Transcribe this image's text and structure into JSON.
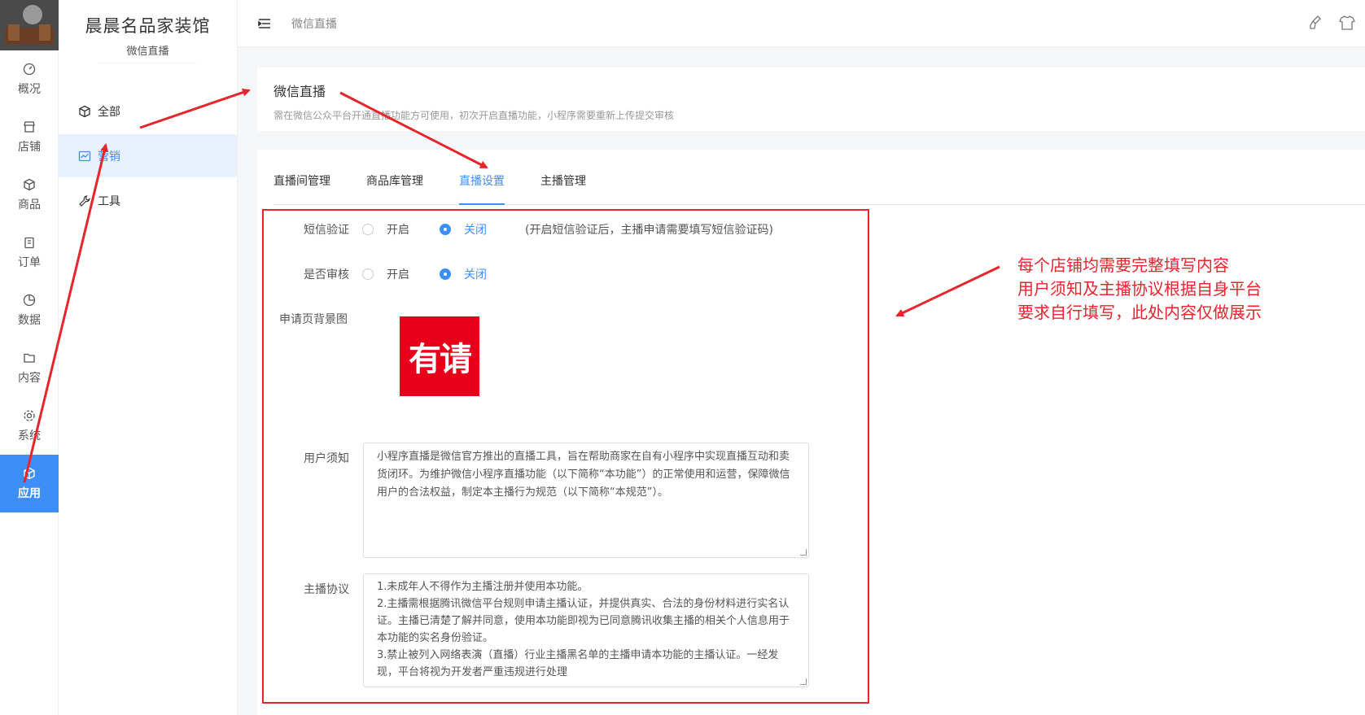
{
  "rail": {
    "items": [
      {
        "label": "概况",
        "icon": "dashboard-icon"
      },
      {
        "label": "店铺",
        "icon": "store-icon"
      },
      {
        "label": "商品",
        "icon": "cube-icon"
      },
      {
        "label": "订单",
        "icon": "clipboard-icon"
      },
      {
        "label": "数据",
        "icon": "pie-chart-icon"
      },
      {
        "label": "内容",
        "icon": "folder-icon"
      },
      {
        "label": "系统",
        "icon": "gear-icon"
      },
      {
        "label": "应用",
        "icon": "cube-icon",
        "active": true
      }
    ]
  },
  "side": {
    "store_name": "晨晨名品家装馆",
    "store_sub": "微信直播",
    "items": [
      {
        "label": "全部",
        "icon": "cube-icon"
      },
      {
        "label": "营销",
        "icon": "chart-line-icon",
        "active": true
      },
      {
        "label": "工具",
        "icon": "wrench-icon"
      }
    ]
  },
  "topbar": {
    "breadcrumb": "微信直播"
  },
  "header": {
    "title": "微信直播",
    "desc": "需在微信公众平台开通直播功能方可使用，初次开启直播功能，小程序需要重新上传提交审核"
  },
  "tabs": [
    {
      "label": "直播间管理"
    },
    {
      "label": "商品库管理"
    },
    {
      "label": "直播设置",
      "active": true
    },
    {
      "label": "主播管理"
    }
  ],
  "form": {
    "sms_label": "短信验证",
    "review_label": "是否审核",
    "on_label": "开启",
    "off_label": "关闭",
    "sms_hint": "(开启短信验证后，主播申请需要填写短信验证码)",
    "bg_label": "申请页背景图",
    "bg_image_text": "有请",
    "notice_label": "用户须知",
    "notice_text": "小程序直播是微信官方推出的直播工具，旨在帮助商家在自有小程序中实现直播互动和卖货闭环。为维护微信小程序直播功能（以下简称“本功能”）的正常使用和运营，保障微信用户的合法权益，制定本主播行为规范（以下简称“本规范”）。",
    "agreement_label": "主播协议",
    "agreement_lines": [
      "1.未成年人不得作为主播注册并使用本功能。",
      "2.主播需根据腾讯微信平台规则申请主播认证，并提供真实、合法的身份材料进行实名认证。主播已清楚了解并同意，使用本功能即视为已同意腾讯收集主播的相关个人信息用于本功能的实名身份验证。",
      "3.禁止被列入网络表演（直播）行业主播黑名单的主播申请本功能的主播认证。一经发现，平台将视为开发者严重违规进行处理"
    ]
  },
  "annotation": {
    "lines": [
      "每个店铺均需要完整填写内容",
      "用户须知及主播协议根据自身平台",
      "要求自行填写，此处内容仅做展示"
    ],
    "color": "#e7252c"
  },
  "colors": {
    "accent": "#3e8ef7",
    "annotation_red": "#e7252c"
  }
}
